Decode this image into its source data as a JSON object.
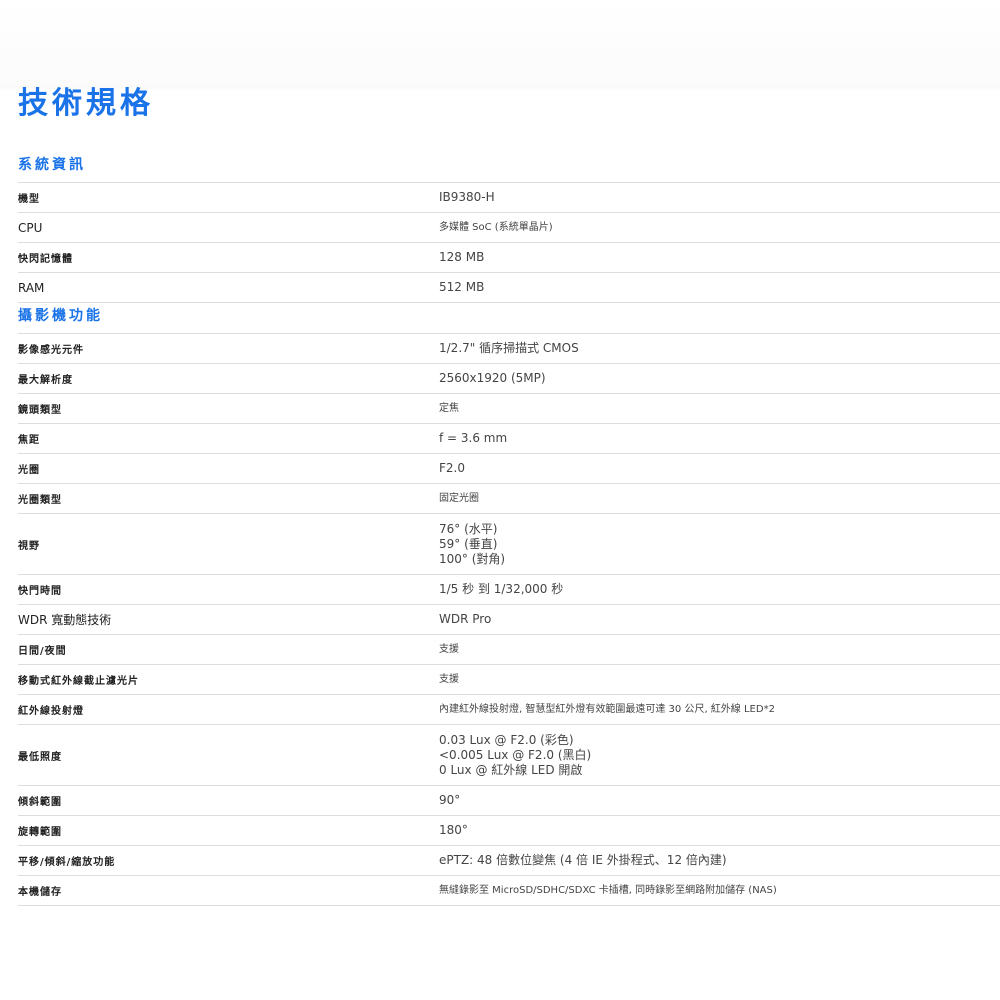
{
  "page": {
    "title": "技術規格"
  },
  "sections": [
    {
      "title": "系統資訊",
      "rows": [
        {
          "label": "機型",
          "value": [
            "IB9380-H"
          ]
        },
        {
          "label": "CPU",
          "value": [
            "多媒體 SoC (系統單晶片)"
          ]
        },
        {
          "label": "快閃記憶體",
          "value": [
            "128 MB"
          ]
        },
        {
          "label": "RAM",
          "value": [
            "512 MB"
          ]
        }
      ]
    },
    {
      "title": "攝影機功能",
      "rows": [
        {
          "label": "影像感光元件",
          "value": [
            "1/2.7\" 循序掃描式 CMOS"
          ]
        },
        {
          "label": "最大解析度",
          "value": [
            "2560x1920 (5MP)"
          ]
        },
        {
          "label": "鏡頭類型",
          "value": [
            "定焦"
          ]
        },
        {
          "label": "焦距",
          "value": [
            "f = 3.6 mm"
          ]
        },
        {
          "label": "光圈",
          "value": [
            "F2.0"
          ]
        },
        {
          "label": "光圈類型",
          "value": [
            "固定光圈"
          ]
        },
        {
          "label": "視野",
          "value": [
            "76° (水平)",
            "59° (垂直)",
            "100° (對角)"
          ]
        },
        {
          "label": "快門時間",
          "value": [
            "1/5 秒 到 1/32,000 秒"
          ]
        },
        {
          "label": "WDR 寬動態技術",
          "value": [
            "WDR Pro"
          ]
        },
        {
          "label": "日間/夜間",
          "value": [
            "支援"
          ]
        },
        {
          "label": "移動式紅外線截止濾光片",
          "value": [
            "支援"
          ]
        },
        {
          "label": "紅外線投射燈",
          "value": [
            "內建紅外線投射燈, 智慧型紅外燈有效範圍最遠可達 30 公尺, 紅外線 LED*2"
          ]
        },
        {
          "label": "最低照度",
          "value": [
            "0.03 Lux @ F2.0 (彩色)",
            "<0.005 Lux @ F2.0 (黑白)",
            "0 Lux @ 紅外線 LED 開啟"
          ]
        },
        {
          "label": "傾斜範圍",
          "value": [
            "90°"
          ]
        },
        {
          "label": "旋轉範圍",
          "value": [
            "180°"
          ]
        },
        {
          "label": "平移/傾斜/縮放功能",
          "value": [
            "ePTZ: 48 倍數位變焦 (4 倍 IE 外掛程式、12 倍內建)"
          ]
        },
        {
          "label": "本機儲存",
          "value": [
            "無縫錄影至 MicroSD/SDHC/SDXC 卡插槽, 同時錄影至網路附加儲存 (NAS)"
          ]
        }
      ]
    }
  ]
}
